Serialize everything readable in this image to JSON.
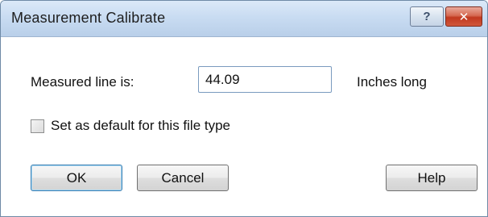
{
  "window": {
    "title": "Measurement Calibrate",
    "help_glyph": "?",
    "close_glyph": "✕"
  },
  "form": {
    "measured_label": "Measured line is:",
    "measured_value": "44.09",
    "units_label": "Inches long",
    "default_checkbox_label": "Set as default for this file type",
    "default_checked": false
  },
  "buttons": {
    "ok": "OK",
    "cancel": "Cancel",
    "help": "Help"
  }
}
